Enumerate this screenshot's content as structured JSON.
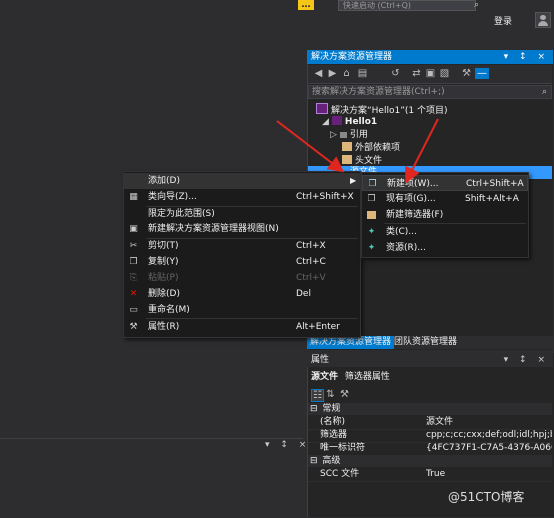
{
  "topbar": {
    "notification_glyph": "…",
    "quick_launch_placeholder": "快速启动 (Ctrl+Q)",
    "login_label": "登录"
  },
  "solution_explorer": {
    "title": "解决方案资源管理器",
    "title_controls": "▾ ↕ ×",
    "search_placeholder": "搜索解决方案资源管理器(Ctrl+;)",
    "tree": {
      "solution": "解决方案“Hello1”(1 个项目)",
      "project": "Hello1",
      "references": "引用",
      "external_deps": "外部依赖项",
      "headers": "头文件",
      "selected_partial": "源文件"
    },
    "tabs": [
      "解决方案资源管理器",
      "团队资源管理器"
    ]
  },
  "properties": {
    "title": "属性",
    "title_controls": "▾ ↕ ×",
    "object_name": "源文件",
    "object_type": "筛选器属性",
    "categories": [
      {
        "name": "常规",
        "rows": [
          {
            "key": "(名称)",
            "value": "源文件"
          },
          {
            "key": "筛选器",
            "value": "cpp;c;cc;cxx;def;odl;idl;hpj;bat"
          },
          {
            "key": "唯一标识符",
            "value": "{4FC737F1-C7A5-4376-A066-2"
          }
        ]
      },
      {
        "name": "高级",
        "rows": [
          {
            "key": "SCC 文件",
            "value": "True"
          }
        ]
      }
    ]
  },
  "left_pane": {
    "controls": "▾ ↕ ×"
  },
  "context_menu": {
    "items": [
      {
        "label": "添加(D)",
        "shortcut": "",
        "submenu": true,
        "disabled": false
      },
      {
        "label": "类向导(Z)...",
        "shortcut": "Ctrl+Shift+X",
        "disabled": false
      },
      {
        "label": "限定为此范围(S)",
        "shortcut": "",
        "disabled": false
      },
      {
        "label": "新建解决方案资源管理器视图(N)",
        "shortcut": "",
        "disabled": false
      },
      {
        "label": "剪切(T)",
        "shortcut": "Ctrl+X",
        "disabled": false
      },
      {
        "label": "复制(Y)",
        "shortcut": "Ctrl+C",
        "disabled": false
      },
      {
        "label": "粘贴(P)",
        "shortcut": "Ctrl+V",
        "disabled": true
      },
      {
        "label": "删除(D)",
        "shortcut": "Del",
        "disabled": false
      },
      {
        "label": "重命名(M)",
        "shortcut": "",
        "disabled": false
      },
      {
        "label": "属性(R)",
        "shortcut": "Alt+Enter",
        "disabled": false
      }
    ]
  },
  "submenu": {
    "items": [
      {
        "label": "新建项(W)...",
        "shortcut": "Ctrl+Shift+A"
      },
      {
        "label": "现有项(G)...",
        "shortcut": "Shift+Alt+A"
      },
      {
        "label": "新建筛选器(F)",
        "shortcut": ""
      },
      {
        "label": "类(C)...",
        "shortcut": ""
      },
      {
        "label": "资源(R)...",
        "shortcut": ""
      }
    ]
  },
  "watermark": "@51CTO博客",
  "colors": {
    "accent": "#007acc",
    "selection": "#3399ff",
    "arrow": "#e0261f"
  }
}
